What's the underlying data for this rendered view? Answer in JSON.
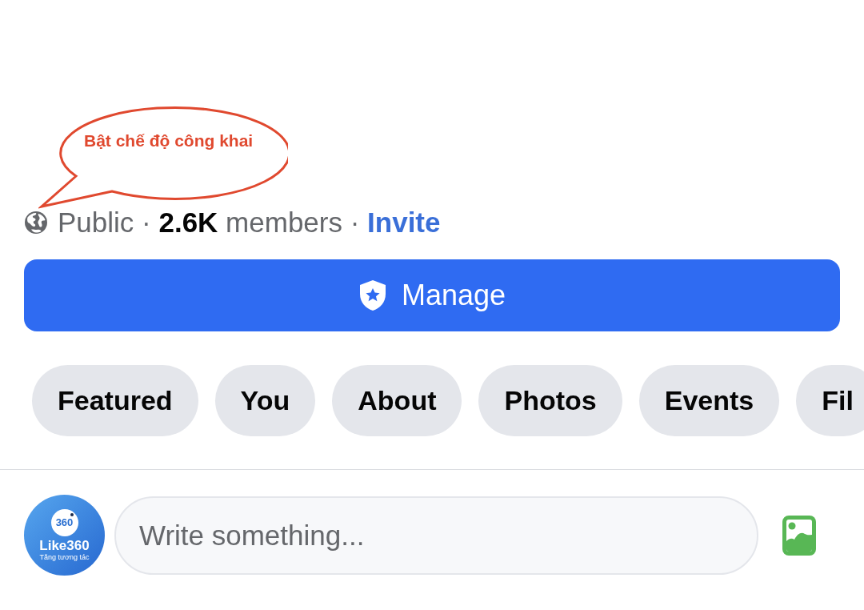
{
  "annotation": {
    "text": "Bật chế độ công khai"
  },
  "group_info": {
    "summary": "Public · **2.6K** members ·",
    "invite_link": "Invite"
  },
  "manage_button": {
    "label": "Manage"
  },
  "tabs": [
    {
      "label": "Featured",
      "selected": false
    },
    {
      "label": "You",
      "selected": false
    },
    {
      "label": "About",
      "selected": false
    },
    {
      "label": "Photos",
      "selected": false
    },
    {
      "label": "Events",
      "selected": false
    },
    {
      "label": "Fil",
      "selected": false
    }
  ],
  "composer": {
    "avatar": {
      "badge": "360",
      "title": "Like360",
      "tagline": "Tăng tương tác"
    },
    "placeholder": "Write something..."
  }
}
